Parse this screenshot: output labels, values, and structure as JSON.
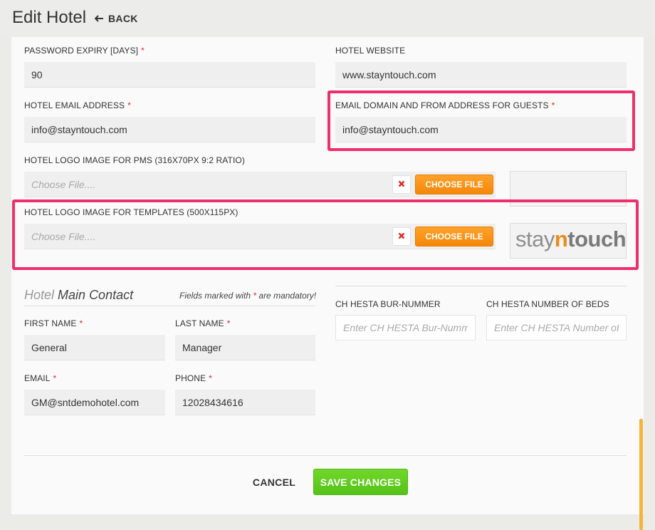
{
  "header": {
    "title": "Edit Hotel",
    "back_label": "BACK"
  },
  "fields": {
    "password_expiry": {
      "label": "PASSWORD EXPIRY [DAYS]",
      "value": "90",
      "required": "*"
    },
    "hotel_website": {
      "label": "HOTEL WEBSITE",
      "value": "www.stayntouch.com"
    },
    "hotel_email": {
      "label": "HOTEL EMAIL ADDRESS",
      "value": "info@stayntouch.com",
      "required": "*"
    },
    "email_domain": {
      "label": "EMAIL DOMAIN AND FROM ADDRESS FOR GUESTS",
      "value": "info@stayntouch.com",
      "required": "*"
    },
    "logo_pms": {
      "label": "HOTEL LOGO IMAGE FOR PMS (316X70PX 9:2 RATIO)",
      "placeholder": "Choose File....",
      "button": "CHOOSE FILE"
    },
    "logo_templates": {
      "label": "HOTEL LOGO IMAGE FOR TEMPLATES (500X115PX)",
      "placeholder": "Choose File....",
      "button": "CHOOSE FILE"
    }
  },
  "logo_preview": {
    "part1": "stay",
    "part2": "n",
    "part3": "touch"
  },
  "main_contact": {
    "title_light": "Hotel",
    "title_main": "Main Contact",
    "mandatory_note_pre": "Fields marked with",
    "mandatory_star": "*",
    "mandatory_note_post": "are mandatory!",
    "first_name": {
      "label": "FIRST NAME",
      "value": "General",
      "required": "*"
    },
    "last_name": {
      "label": "LAST NAME",
      "value": "Manager",
      "required": "*"
    },
    "email": {
      "label": "EMAIL",
      "value": "GM@sntdemohotel.com",
      "required": "*"
    },
    "phone": {
      "label": "PHONE",
      "value": "12028434616",
      "required": "*"
    }
  },
  "ch_hesta": {
    "bur_nummer": {
      "label": "CH HESTA BUR-NUMMER",
      "placeholder": "Enter CH HESTA Bur-Nummer"
    },
    "beds": {
      "label": "CH HESTA NUMBER OF BEDS",
      "placeholder": "Enter CH HESTA Number of Beds"
    }
  },
  "actions": {
    "cancel": "CANCEL",
    "save": "SAVE CHANGES"
  },
  "colors": {
    "accent_orange": "#f5870a",
    "save_green": "#55c217",
    "highlight_pink": "#ef2f6a",
    "required_red": "#e0261e"
  }
}
